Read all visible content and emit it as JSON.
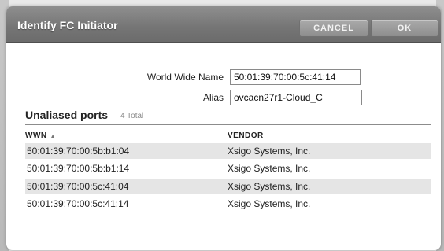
{
  "dialog": {
    "title": "Identify FC Initiator",
    "cancel_label": "CANCEL",
    "ok_label": "OK"
  },
  "form": {
    "wwn_label": "World Wide Name",
    "wwn_value": "50:01:39:70:00:5c:41:14",
    "alias_label": "Alias",
    "alias_value": "ovcacn27r1-Cloud_C"
  },
  "ports": {
    "title": "Unaliased ports",
    "count": "4 Total",
    "columns": {
      "wwn": "WWN",
      "vendor": "VENDOR"
    },
    "sort_indicator": "▲",
    "rows": [
      {
        "wwn": "50:01:39:70:00:5b:b1:04",
        "vendor": "Xsigo Systems, Inc."
      },
      {
        "wwn": "50:01:39:70:00:5b:b1:14",
        "vendor": "Xsigo Systems, Inc."
      },
      {
        "wwn": "50:01:39:70:00:5c:41:04",
        "vendor": "Xsigo Systems, Inc."
      },
      {
        "wwn": "50:01:39:70:00:5c:41:14",
        "vendor": "Xsigo Systems, Inc."
      }
    ]
  }
}
